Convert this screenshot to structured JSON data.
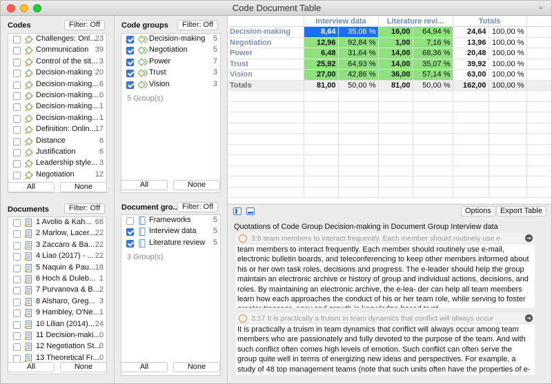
{
  "window": {
    "title": "Code Document Table"
  },
  "codes": {
    "title": "Codes",
    "filter": "Filter: Off",
    "items": [
      {
        "label": "Challenges: Onl...",
        "count": "23"
      },
      {
        "label": "Communication",
        "count": "39"
      },
      {
        "label": "Control of the sit...",
        "count": "3"
      },
      {
        "label": "Decision-making",
        "count": "20"
      },
      {
        "label": "Decision-making...",
        "count": "6"
      },
      {
        "label": "Decision-making...",
        "count": "0"
      },
      {
        "label": "Decision-making...",
        "count": "1"
      },
      {
        "label": "Decision-making...",
        "count": "1"
      },
      {
        "label": "Definition: Onlin...",
        "count": "17"
      },
      {
        "label": "Distance",
        "count": "6"
      },
      {
        "label": "Justification",
        "count": "6"
      },
      {
        "label": "Leadership style...",
        "count": "3"
      },
      {
        "label": "Negotiation",
        "count": "12"
      }
    ],
    "all": "All",
    "none": "None"
  },
  "code_groups": {
    "title": "Code groups",
    "filter": "Filter: Off",
    "items": [
      {
        "label": "Decision-making",
        "count": "5",
        "checked": true
      },
      {
        "label": "Negotiation",
        "count": "5",
        "checked": true
      },
      {
        "label": "Power",
        "count": "7",
        "checked": true
      },
      {
        "label": "Trust",
        "count": "3",
        "checked": true
      },
      {
        "label": "Vision",
        "count": "3",
        "checked": true
      }
    ],
    "summary": "5 Group(s)",
    "all": "All",
    "none": "None"
  },
  "documents": {
    "title": "Documents",
    "filter": "Filter: Off",
    "items": [
      {
        "label": "1 Avolio & Kah...",
        "count": "68"
      },
      {
        "label": "2 Marlow, Lacer...",
        "count": "22"
      },
      {
        "label": "3 Zaccaro & Ba...",
        "count": "22"
      },
      {
        "label": "4 Liao (2017) - ...",
        "count": "22"
      },
      {
        "label": "5 Naquin & Pau...",
        "count": "18"
      },
      {
        "label": "6 Hoch & Duleb...",
        "count": "1"
      },
      {
        "label": "7 Purvanova & B...",
        "count": "2"
      },
      {
        "label": "8 Alsharo, Greg...",
        "count": "3"
      },
      {
        "label": "9 Hambley, O'Ne...",
        "count": "1"
      },
      {
        "label": "10 Lilian (2014)...",
        "count": "24"
      },
      {
        "label": "11 Decision-maki...",
        "count": "0"
      },
      {
        "label": "12 Negotiation St...",
        "count": "0"
      },
      {
        "label": "13 Theoretical Fr...",
        "count": "0"
      }
    ],
    "all": "All",
    "none": "None"
  },
  "document_groups": {
    "title": "Document gro...",
    "filter": "Filter: Off",
    "items": [
      {
        "label": "Frameworks",
        "count": "5",
        "checked": false
      },
      {
        "label": "Interview data",
        "count": "5",
        "checked": true
      },
      {
        "label": "Literature review",
        "count": "5",
        "checked": true
      }
    ],
    "summary": "3 Group(s)",
    "all": "All",
    "none": "None"
  },
  "table": {
    "columns": [
      "Interview data",
      "Literature revi...",
      "Totals"
    ],
    "rows": [
      {
        "name": "Decision-making",
        "a": "8,64",
        "ap": "35,06 %",
        "b": "16,00",
        "bp": "64,94 %",
        "t": "24,64",
        "tp": "100,00 %"
      },
      {
        "name": "Negotiation",
        "a": "12,96",
        "ap": "92,84 %",
        "b": "1,00",
        "bp": "7,16 %",
        "t": "13,96",
        "tp": "100,00 %"
      },
      {
        "name": "Power",
        "a": "6,48",
        "ap": "31,64 %",
        "b": "14,00",
        "bp": "68,36 %",
        "t": "20,48",
        "tp": "100,00 %"
      },
      {
        "name": "Trust",
        "a": "25,92",
        "ap": "64,93 %",
        "b": "14,00",
        "bp": "35,07 %",
        "t": "39,92",
        "tp": "100,00 %"
      },
      {
        "name": "Vision",
        "a": "27,00",
        "ap": "42,86 %",
        "b": "36,00",
        "bp": "57,14 %",
        "t": "63,00",
        "tp": "100,00 %"
      }
    ],
    "totals": {
      "name": "Totals",
      "a": "81,00",
      "ap": "50,00 %",
      "b": "81,00",
      "bp": "50,00 %",
      "t": "162,00",
      "tp": "100,00 %"
    },
    "colors": {
      "green": "#8fe07f",
      "selected": "#1b6ff0"
    }
  },
  "toolbar": {
    "options": "Options",
    "export": "Export Table"
  },
  "quotations": {
    "header": "Quotations of Code Group Decision-making in Document Group Interview data",
    "items": [
      {
        "ref": "3:8 team members to interact frequently. Each member should routinely use e-",
        "text": "team members to interact frequently. Each member should routinely use e-mail, electronic bulletin boards, and teleconferencing to keep other members informed about his or her own task roles, decisions and progress. The e-leader should help the group maintain an electronic archive or history of group and individual actions, decisions, and roles. By maintaining an electronic archive, the e-lea- der can help all team members learn how each approaches the conduct of his or her team role, while serving to foster greater transpar- ency and growth in knowledge-based trust."
      },
      {
        "ref": "3:17 It is practically a truism in team dynamics that conflict will always occur",
        "text": "It is practically a truism in team dynamics that conflict will always occur among team members who are passionately and fully devoted to the purpose of the team. And with such conflict often comes high levels of emotion. Such conflict can often serve the group quite well in terms of energizing new ideas and perspectives. For example, a study of 48 top management teams (note that such units often have the properties of e-teams) conducted by Allan Amason, showed that conflict that was task-focused and"
      }
    ]
  }
}
